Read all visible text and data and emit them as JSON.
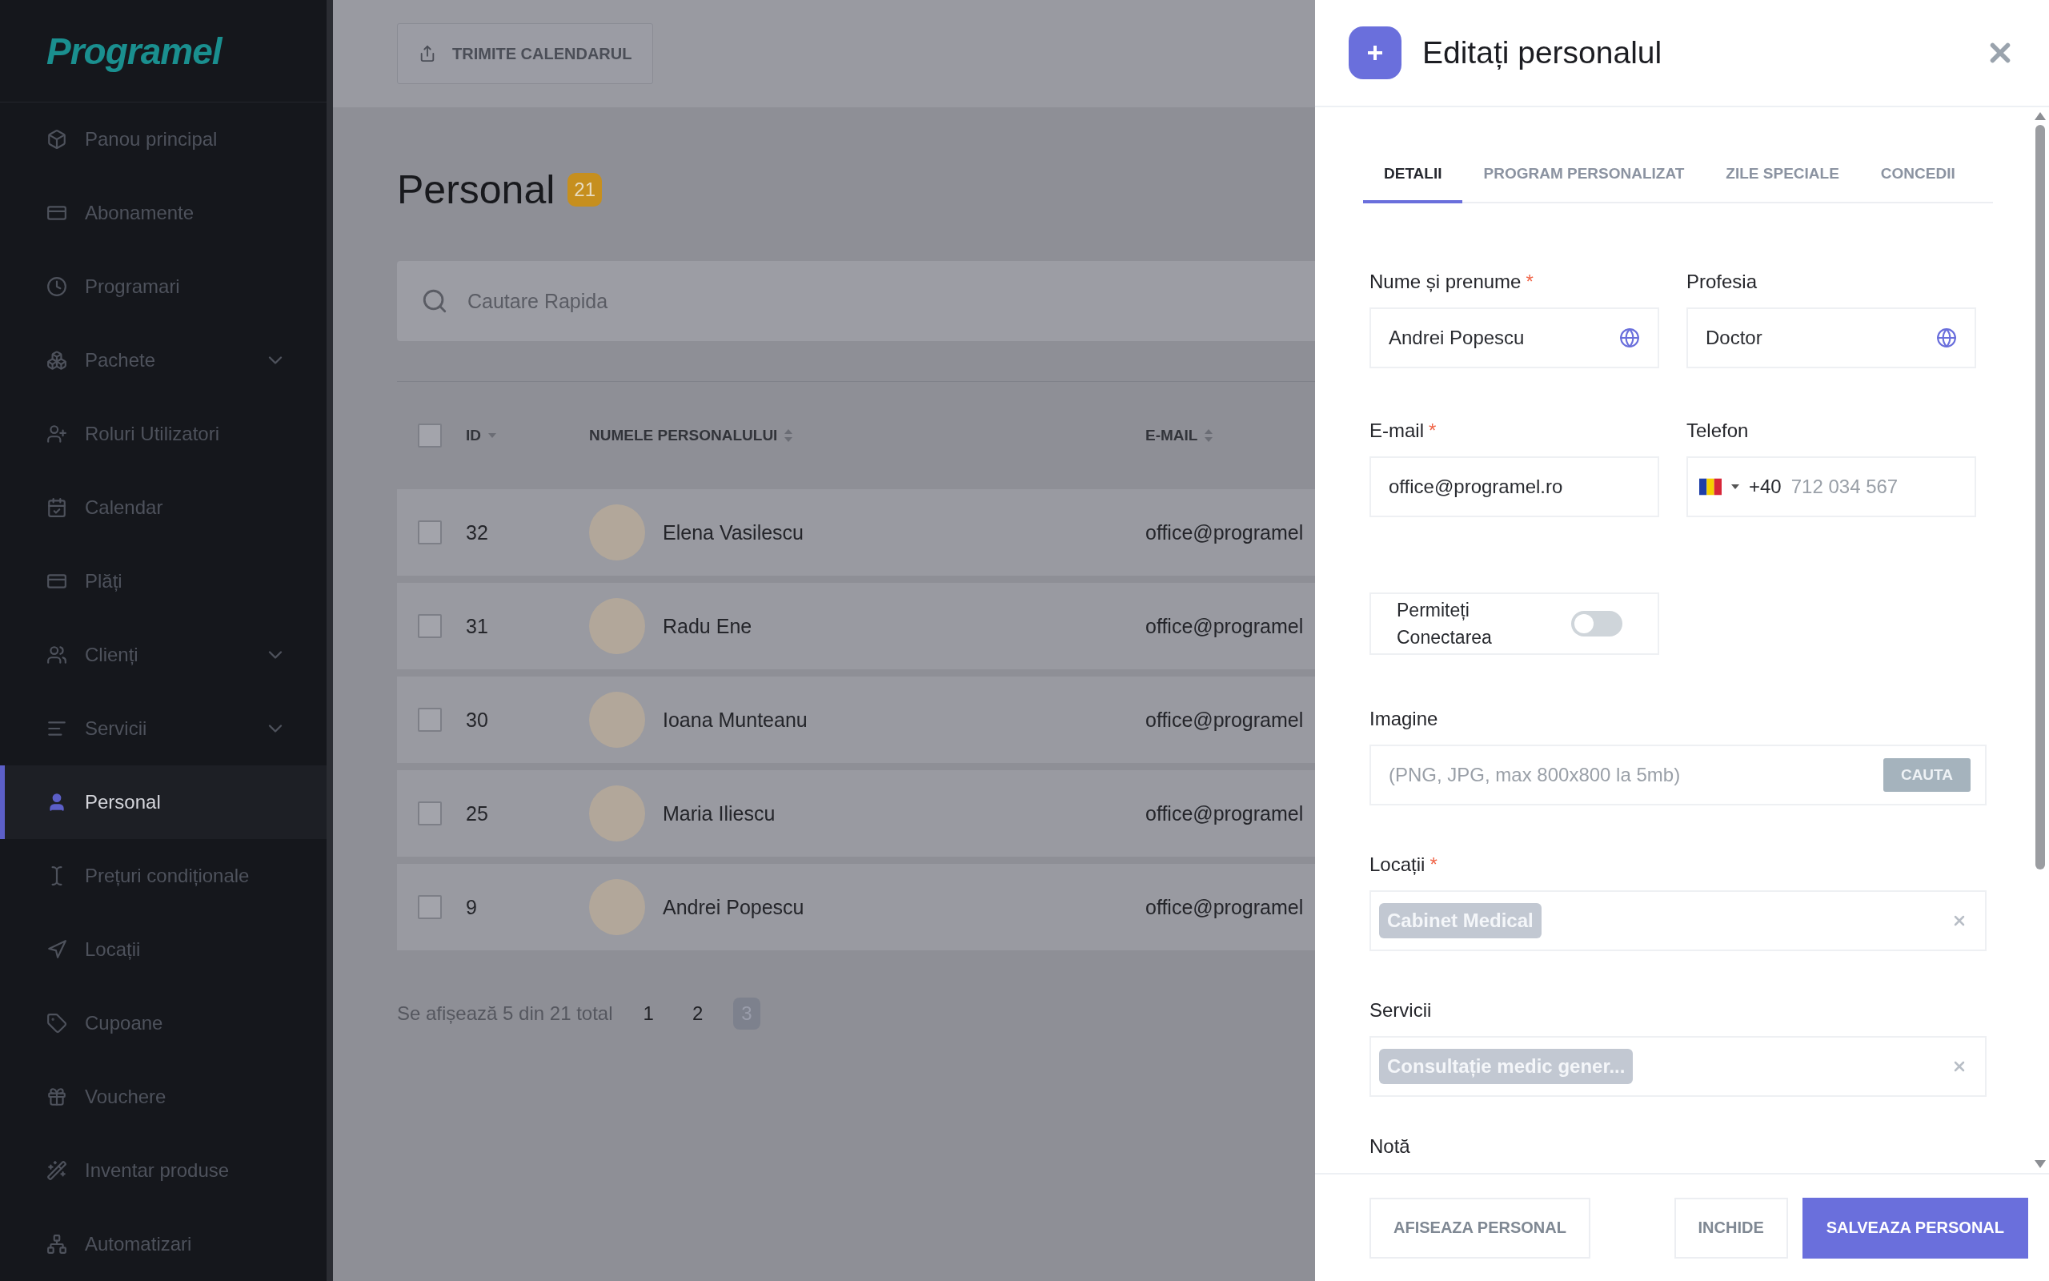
{
  "sidebar": {
    "logo": "Programel",
    "items": [
      {
        "label": "Panou principal",
        "expandable": false,
        "selected": false
      },
      {
        "label": "Abonamente",
        "expandable": false,
        "selected": false
      },
      {
        "label": "Programari",
        "expandable": false,
        "selected": false
      },
      {
        "label": "Pachete",
        "expandable": true,
        "selected": false
      },
      {
        "label": "Roluri Utilizatori",
        "expandable": false,
        "selected": false
      },
      {
        "label": "Calendar",
        "expandable": false,
        "selected": false
      },
      {
        "label": "Plăți",
        "expandable": false,
        "selected": false
      },
      {
        "label": "Clienți",
        "expandable": true,
        "selected": false
      },
      {
        "label": "Servicii",
        "expandable": true,
        "selected": false
      },
      {
        "label": "Personal",
        "expandable": false,
        "selected": true
      },
      {
        "label": "Prețuri condiționale",
        "expandable": false,
        "selected": false
      },
      {
        "label": "Locații",
        "expandable": false,
        "selected": false
      },
      {
        "label": "Cupoane",
        "expandable": false,
        "selected": false
      },
      {
        "label": "Vouchere",
        "expandable": false,
        "selected": false
      },
      {
        "label": "Inventar produse",
        "expandable": false,
        "selected": false
      },
      {
        "label": "Automatizari",
        "expandable": false,
        "selected": false
      }
    ]
  },
  "toolbar": {
    "button": "TRIMITE CALENDARUL"
  },
  "page": {
    "title": "Personal",
    "count": "21"
  },
  "search": {
    "placeholder": "Cautare Rapida"
  },
  "table": {
    "select_all_checked": false,
    "columns": [
      {
        "label": "ID",
        "sorted": true
      },
      {
        "label": "NUMELE PERSONALULUI",
        "sorted": false
      },
      {
        "label": "E-MAIL",
        "sorted": false
      }
    ],
    "rows": [
      {
        "id": "32",
        "name": "Elena Vasilescu",
        "email": "office@programel",
        "checked": false
      },
      {
        "id": "31",
        "name": "Radu Ene",
        "email": "office@programel",
        "checked": false
      },
      {
        "id": "30",
        "name": "Ioana Munteanu",
        "email": "office@programel",
        "checked": false
      },
      {
        "id": "25",
        "name": "Maria Iliescu",
        "email": "office@programel",
        "checked": false
      },
      {
        "id": "9",
        "name": "Andrei Popescu",
        "email": "office@programel",
        "checked": false
      }
    ]
  },
  "pagination": {
    "summary": "Se afișează 5 din 21 total",
    "pages": [
      {
        "label": "1",
        "selected": false
      },
      {
        "label": "2",
        "selected": false
      },
      {
        "label": "3",
        "selected": true
      }
    ]
  },
  "panel": {
    "title": "Editați personalul",
    "tabs": [
      {
        "label": "DETALII",
        "selected": true
      },
      {
        "label": "PROGRAM PERSONALIZAT",
        "selected": false
      },
      {
        "label": "ZILE SPECIALE",
        "selected": false
      },
      {
        "label": "CONCEDII",
        "selected": false
      }
    ],
    "name_field": {
      "label": "Nume și prenume",
      "required_mark": "*",
      "value": "Andrei Popescu"
    },
    "profession_field": {
      "label": "Profesia",
      "value": "Doctor"
    },
    "email_field": {
      "label": "E-mail",
      "required_mark": "*",
      "value": "office@programel.ro"
    },
    "phone_field": {
      "label": "Telefon",
      "dial_code": "+40",
      "placeholder": "712 034 567"
    },
    "login_toggle": {
      "label": "Permiteți Conectarea",
      "on": false
    },
    "image_field": {
      "label": "Imagine",
      "placeholder": "(PNG, JPG, max 800x800 la 5mb)",
      "button": "CAUTA"
    },
    "locations_field": {
      "label": "Locații",
      "required_mark": "*",
      "chips": [
        "Cabinet Medical"
      ]
    },
    "services_field": {
      "label": "Servicii",
      "chips": [
        "Consultație medic gener..."
      ]
    },
    "note_field": {
      "label": "Notă"
    },
    "footer": {
      "show_button": "AFISEAZA PERSONAL",
      "close_button": "INCHIDE",
      "save_button": "SALVEAZA PERSONAL"
    }
  }
}
